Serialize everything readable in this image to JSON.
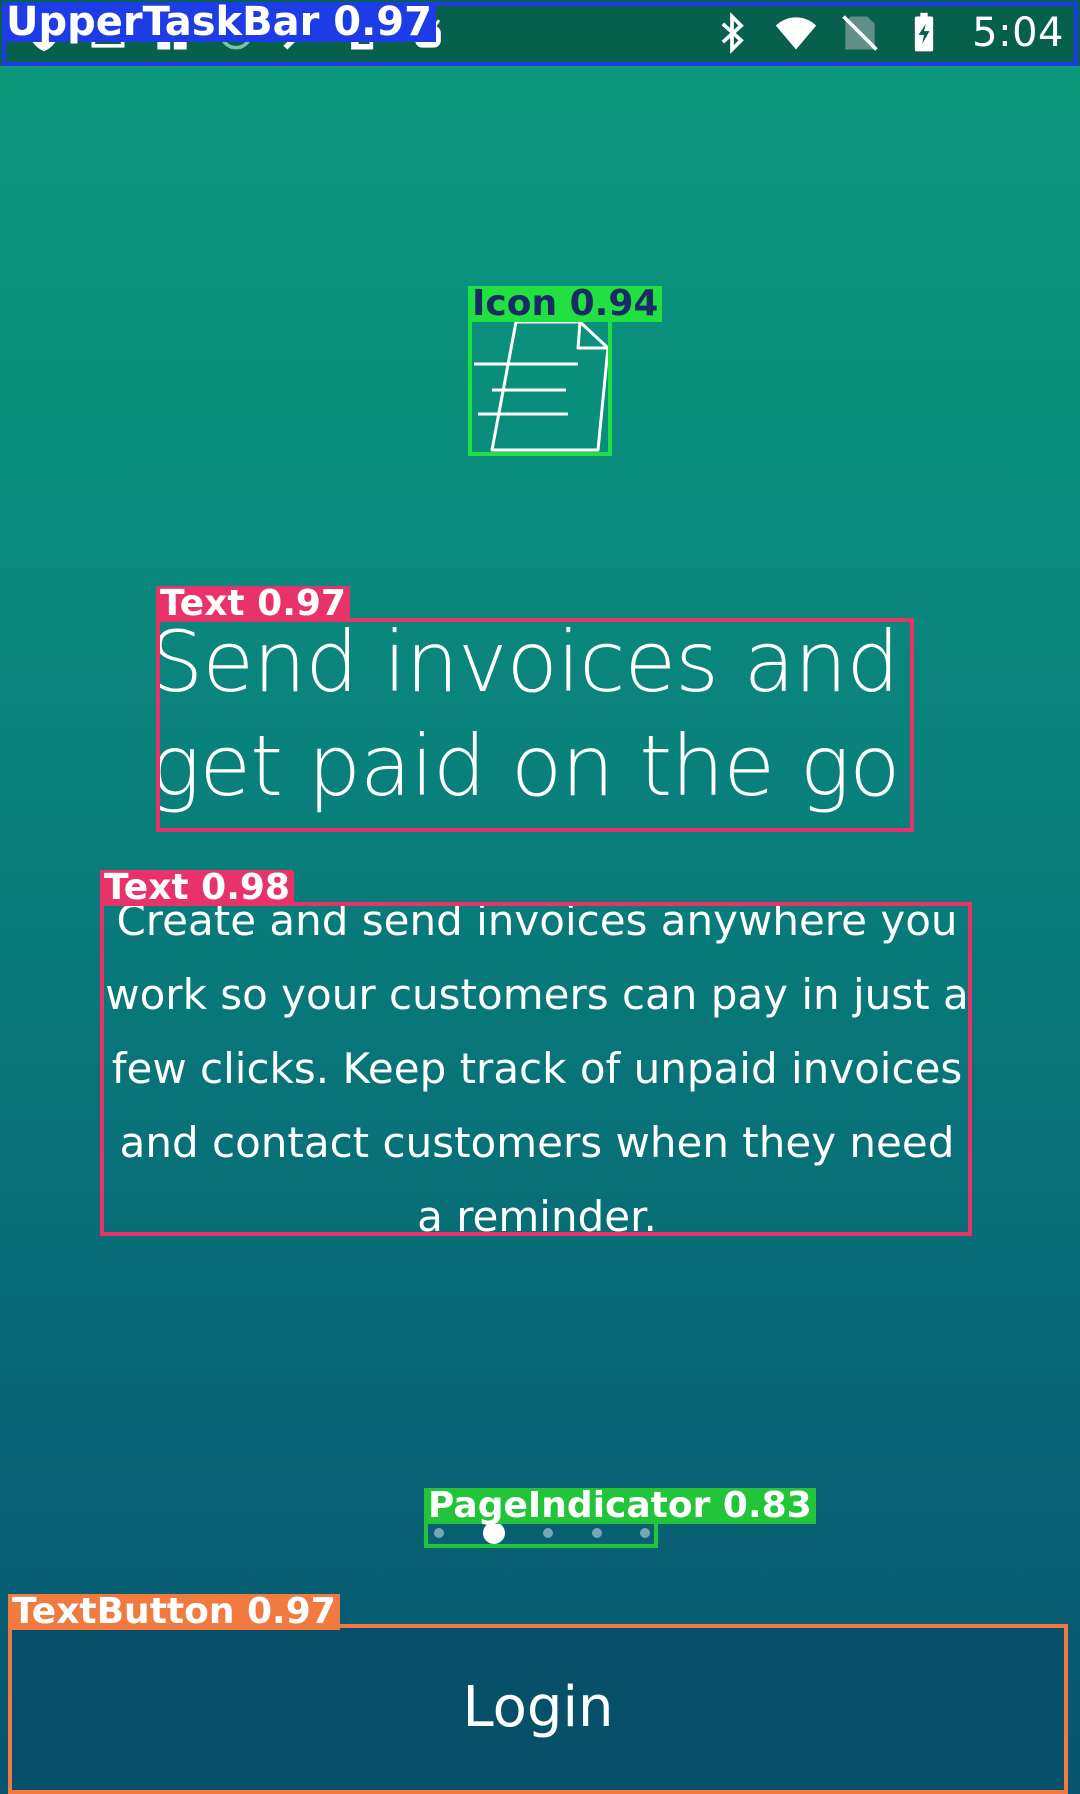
{
  "status_bar": {
    "time": "5:04",
    "left_icons": [
      "shield-icon",
      "download-icon",
      "gift-icon",
      "sync-icon",
      "wrench-icon",
      "sd-card-icon",
      "android-icon"
    ],
    "right_icons": [
      "bluetooth-icon",
      "wifi-icon",
      "no-sim-icon",
      "battery-charging-icon"
    ]
  },
  "onboarding": {
    "icon": "document-icon",
    "headline": "Send invoices and\nget paid on the go",
    "body": "Create and send invoices anywhere you work so your customers can pay in just a few clicks. Keep track of unpaid invoices and contact customers when they need a reminder.",
    "page_indicator": {
      "count": 5,
      "active_index": 1
    }
  },
  "login_button": {
    "label": "Login"
  },
  "detections": [
    {
      "label": "UpperTaskBar",
      "score": "0.97",
      "text": "UpperTaskBar 0.97",
      "color": "#1e3ce6",
      "tag_bg": "#1e3ce6",
      "tag_fg": "#ffffff"
    },
    {
      "label": "Icon",
      "score": "0.94",
      "text": "Icon 0.94",
      "color": "#22e040",
      "tag_bg": "#22e040",
      "tag_fg": "#1a2a66"
    },
    {
      "label": "Text",
      "score": "0.97",
      "text": "Text 0.97",
      "color": "#e8336a",
      "tag_bg": "#e8336a",
      "tag_fg": "#ffffff"
    },
    {
      "label": "Text",
      "score": "0.98",
      "text": "Text 0.98",
      "color": "#e8336a",
      "tag_bg": "#e8336a",
      "tag_fg": "#ffffff"
    },
    {
      "label": "PageIndicator",
      "score": "0.83",
      "text": "PageIndicator 0.83",
      "color": "#22c43a",
      "tag_bg": "#22c43a",
      "tag_fg": "#ffffff"
    },
    {
      "label": "TextButton",
      "score": "0.97",
      "text": "TextButton 0.97",
      "color": "#f07a40",
      "tag_bg": "#f07a40",
      "tag_fg": "#ffffff"
    }
  ]
}
